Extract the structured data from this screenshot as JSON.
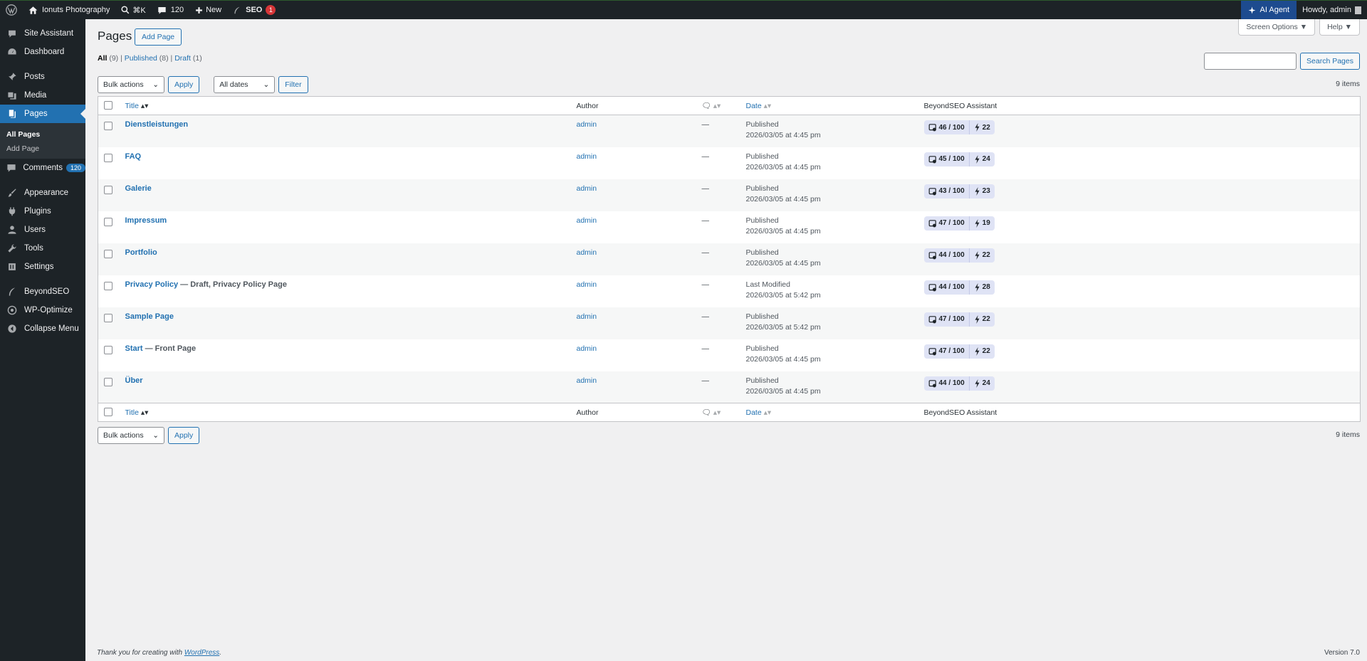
{
  "adminbar": {
    "site_name": "Ionuts Photography",
    "command_shortcut": "⌘K",
    "comments_count": "120",
    "new_label": "New",
    "seo_label": "SEO",
    "seo_badge": "1",
    "ai_agent": "AI Agent",
    "howdy": "Howdy, admin"
  },
  "sidebar": {
    "site_assistant": "Site Assistant",
    "dashboard": "Dashboard",
    "posts": "Posts",
    "media": "Media",
    "pages": "Pages",
    "all_pages": "All Pages",
    "add_page": "Add Page",
    "comments": "Comments",
    "comments_badge": "120",
    "appearance": "Appearance",
    "plugins": "Plugins",
    "users": "Users",
    "tools": "Tools",
    "settings": "Settings",
    "beyondseo": "BeyondSEO",
    "wp_optimize": "WP-Optimize",
    "collapse": "Collapse Menu"
  },
  "header": {
    "screen_options": "Screen Options ▼",
    "help": "Help ▼",
    "title": "Pages",
    "add_page": "Add Page"
  },
  "filters": {
    "all": "All",
    "all_count": "(9)",
    "published": "Published",
    "published_count": "(8)",
    "draft": "Draft",
    "draft_count": "(1)",
    "search_button": "Search Pages",
    "bulk_actions": "Bulk actions",
    "apply": "Apply",
    "all_dates": "All dates",
    "filter": "Filter",
    "items_count": "9 items"
  },
  "table": {
    "col_title": "Title",
    "col_author": "Author",
    "col_date": "Date",
    "col_seo": "BeyondSEO Assistant",
    "rows": [
      {
        "title": "Dienstleistungen",
        "state": "",
        "author": "admin",
        "comments": "—",
        "status": "Published",
        "date": "2026/03/05 at 4:45 pm",
        "score": "46 / 100",
        "links": "22"
      },
      {
        "title": "FAQ",
        "state": "",
        "author": "admin",
        "comments": "—",
        "status": "Published",
        "date": "2026/03/05 at 4:45 pm",
        "score": "45 / 100",
        "links": "24"
      },
      {
        "title": "Galerie",
        "state": "",
        "author": "admin",
        "comments": "—",
        "status": "Published",
        "date": "2026/03/05 at 4:45 pm",
        "score": "43 / 100",
        "links": "23"
      },
      {
        "title": "Impressum",
        "state": "",
        "author": "admin",
        "comments": "—",
        "status": "Published",
        "date": "2026/03/05 at 4:45 pm",
        "score": "47 / 100",
        "links": "19"
      },
      {
        "title": "Portfolio",
        "state": "",
        "author": "admin",
        "comments": "—",
        "status": "Published",
        "date": "2026/03/05 at 4:45 pm",
        "score": "44 / 100",
        "links": "22"
      },
      {
        "title": "Privacy Policy",
        "state": " — Draft, Privacy Policy Page",
        "author": "admin",
        "comments": "—",
        "status": "Last Modified",
        "date": "2026/03/05 at 5:42 pm",
        "score": "44 / 100",
        "links": "28"
      },
      {
        "title": "Sample Page",
        "state": "",
        "author": "admin",
        "comments": "—",
        "status": "Published",
        "date": "2026/03/05 at 5:42 pm",
        "score": "47 / 100",
        "links": "22"
      },
      {
        "title": "Start",
        "state": " — Front Page",
        "author": "admin",
        "comments": "—",
        "status": "Published",
        "date": "2026/03/05 at 4:45 pm",
        "score": "47 / 100",
        "links": "22"
      },
      {
        "title": "Über",
        "state": "",
        "author": "admin",
        "comments": "—",
        "status": "Published",
        "date": "2026/03/05 at 4:45 pm",
        "score": "44 / 100",
        "links": "24"
      }
    ]
  },
  "footer": {
    "thanks": "Thank you for creating with ",
    "wordpress": "WordPress",
    "period": ".",
    "version": "Version 7.0"
  }
}
